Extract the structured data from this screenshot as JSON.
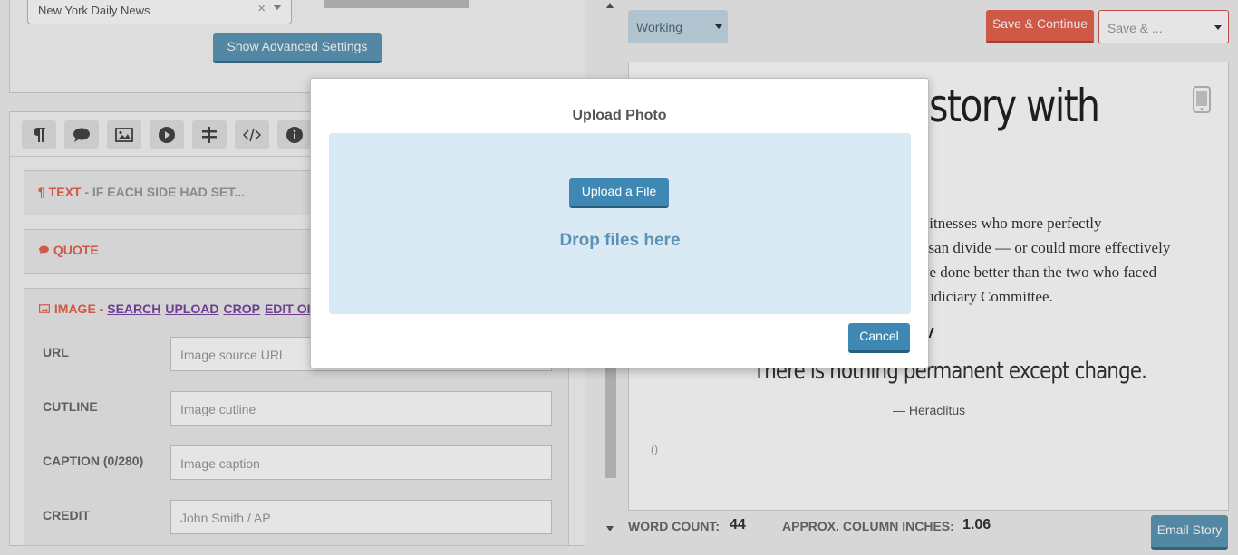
{
  "publication": {
    "value": "New York Daily News",
    "clear_symbol": "×"
  },
  "advanced_settings_label": "Show Advanced Settings",
  "toolbar": {
    "buttons": [
      "paragraph-icon",
      "quote-bubble-icon",
      "image-icon",
      "play-icon",
      "signpost-icon",
      "code-icon",
      "info-icon"
    ]
  },
  "blocks": {
    "text": {
      "type_label": "¶ TEXT",
      "rest": " - IF EACH SIDE HAD SET..."
    },
    "quote": {
      "type_label": "QUOTE"
    },
    "image": {
      "type_label": "IMAGE",
      "separator": " - ",
      "links": [
        "SEARCH",
        "UPLOAD",
        "CROP",
        "EDIT OI"
      ]
    }
  },
  "fields": {
    "url": {
      "label": "URL",
      "placeholder": "Image source URL"
    },
    "cutline": {
      "label": "CUTLINE",
      "placeholder": "Image cutline"
    },
    "caption": {
      "label": "CAPTION (0/280)",
      "placeholder": "Image caption"
    },
    "credit": {
      "label": "CREDIT",
      "placeholder": "John Smith / AP"
    }
  },
  "status_select": {
    "value": "Working"
  },
  "save_continue_label": "Save & Continue",
  "save_as": {
    "value": "Save & ..."
  },
  "preview": {
    "title_fragment": "ble story with",
    "body_lines": [
      "witnesses who more perfectly",
      "tisan divide — or could more effectively",
      "ve done better than the two who faced",
      "udiciary Committee."
    ],
    "heading_fragment": "V",
    "quote_text": "There is nothing permanent except change.",
    "quote_attribution": "— Heraclitus",
    "empty_parens": "()"
  },
  "stats": {
    "word_count_label": "WORD COUNT:",
    "word_count_value": "44",
    "column_inches_label": "APPROX. COLUMN INCHES:",
    "column_inches_value": "1.06"
  },
  "email_story_label": "Email Story",
  "modal": {
    "title": "Upload Photo",
    "upload_button_label": "Upload a File",
    "drop_text": "Drop files here",
    "cancel_label": "Cancel"
  },
  "colors": {
    "accent_red": "#e8624f",
    "accent_blue": "#3f88b3",
    "dropzone": "#daeaf4",
    "link_purple": "#7a45a4"
  }
}
